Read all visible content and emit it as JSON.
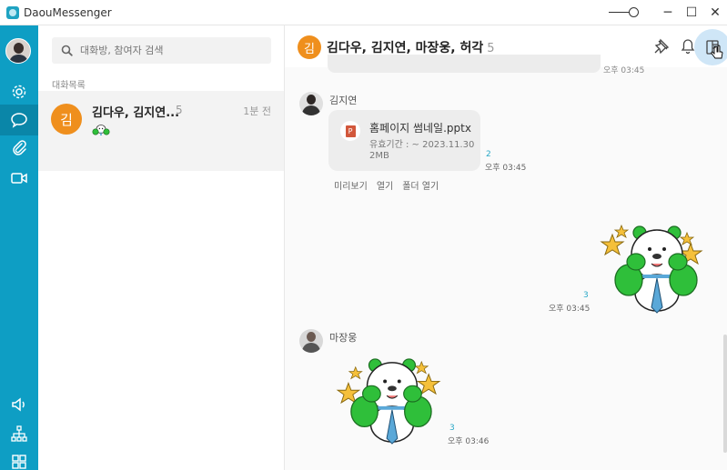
{
  "window": {
    "title": "DaouMessenger",
    "minimize_glyph": "─",
    "maximize_glyph": "☐",
    "close_glyph": "✕"
  },
  "rail": {
    "icons": [
      "settings-icon",
      "chat-icon",
      "attachment-icon",
      "video-icon",
      "speaker-icon",
      "org-chart-icon",
      "apps-grid-icon"
    ]
  },
  "sidebar": {
    "search_placeholder": "대화방, 참여자 검색",
    "section_label": "대화목록",
    "chats": [
      {
        "avatar_text": "김",
        "name": "김다우, 김지연...",
        "count": "5",
        "time": "1분 전",
        "preview_icon": "sticker-icon"
      }
    ]
  },
  "chat": {
    "header": {
      "avatar_text": "김",
      "title": "김다우, 김지연, 마장웅, 허각",
      "count": "5",
      "icons": [
        "pin-icon",
        "bell-icon",
        "side-panel-icon"
      ]
    },
    "prev_time": "오후 03:45",
    "messages": [
      {
        "sender": "김지연",
        "type": "file",
        "file_name": "홈페이지 썸네일.pptx",
        "file_icon_letter": "P",
        "expiry": "유효기간 : ~ 2023.11.30",
        "size": "2MB",
        "read_count": "2",
        "time": "오후 03:45",
        "actions": [
          "미리보기",
          "열기",
          "폴더 열기"
        ]
      },
      {
        "sender": "me",
        "type": "sticker",
        "read_count": "3",
        "time": "오후 03:45"
      },
      {
        "sender": "마장웅",
        "type": "sticker",
        "read_count": "3",
        "time": "오후 03:46"
      }
    ]
  },
  "colors": {
    "rail": "#0e9ec4",
    "rail_active": "#0a86a8",
    "avatar_orange": "#ef8f1d",
    "read_count": "#2aa8c7",
    "sticker_green": "#2fbf3a",
    "sticker_star": "#f5c03a",
    "sticker_tie": "#5aa8d8"
  }
}
